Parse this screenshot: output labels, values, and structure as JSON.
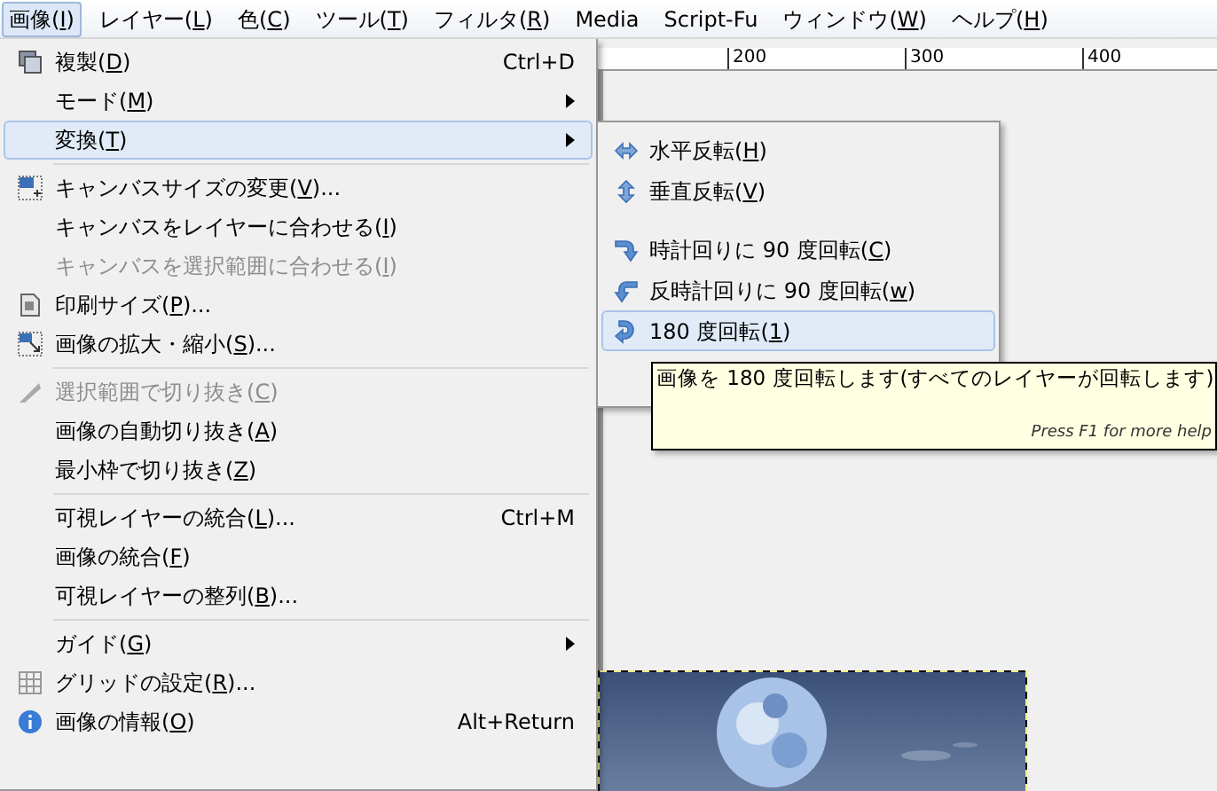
{
  "menubar": [
    {
      "before": "画像(",
      "mnemonic": "I",
      "after": ")",
      "selected": true
    },
    {
      "before": "レイヤー(",
      "mnemonic": "L",
      "after": ")",
      "selected": false
    },
    {
      "before": "色(",
      "mnemonic": "C",
      "after": ")",
      "selected": false
    },
    {
      "before": "ツール(",
      "mnemonic": "T",
      "after": ")",
      "selected": false
    },
    {
      "before": "フィルタ(",
      "mnemonic": "R",
      "after": ")",
      "selected": false
    },
    {
      "before": "Media",
      "selected": false
    },
    {
      "before": "Script-Fu",
      "selected": false
    },
    {
      "before": "ウィンドウ(",
      "mnemonic": "W",
      "after": ")",
      "selected": false
    },
    {
      "before": "ヘルプ(",
      "mnemonic": "H",
      "after": ")",
      "selected": false
    }
  ],
  "ruler": {
    "labels": [
      "200",
      "300",
      "400"
    ]
  },
  "image_menu": {
    "groups": [
      [
        {
          "before": "複製(",
          "mnemonic": "D",
          "after": ")",
          "shortcut": "Ctrl+D",
          "submenu": false,
          "selected": false,
          "disabled": false
        },
        {
          "before": "モード(",
          "mnemonic": "M",
          "after": ")",
          "submenu": true,
          "selected": false,
          "disabled": false
        },
        {
          "before": "変換(",
          "mnemonic": "T",
          "after": ")",
          "submenu": true,
          "selected": true,
          "disabled": false
        }
      ],
      [
        {
          "before": "キャンバスサイズの変更(",
          "mnemonic": "V",
          "after": ")...",
          "submenu": false,
          "selected": false,
          "disabled": false
        },
        {
          "before": "キャンバスをレイヤーに合わせる(",
          "mnemonic": "I",
          "after": ")",
          "submenu": false,
          "selected": false,
          "disabled": false
        },
        {
          "before": "キャンバスを選択範囲に合わせる(",
          "mnemonic": "I",
          "after": ")",
          "submenu": false,
          "selected": false,
          "disabled": true
        },
        {
          "before": "印刷サイズ(",
          "mnemonic": "P",
          "after": ")...",
          "submenu": false,
          "selected": false,
          "disabled": false
        },
        {
          "before": "画像の拡大・縮小(",
          "mnemonic": "S",
          "after": ")...",
          "submenu": false,
          "selected": false,
          "disabled": false
        }
      ],
      [
        {
          "before": "選択範囲で切り抜き(",
          "mnemonic": "C",
          "after": ")",
          "submenu": false,
          "selected": false,
          "disabled": true
        },
        {
          "before": "画像の自動切り抜き(",
          "mnemonic": "A",
          "after": ")",
          "submenu": false,
          "selected": false,
          "disabled": false
        },
        {
          "before": "最小枠で切り抜き(",
          "mnemonic": "Z",
          "after": ")",
          "submenu": false,
          "selected": false,
          "disabled": false
        }
      ],
      [
        {
          "before": "可視レイヤーの統合(",
          "mnemonic": "L",
          "after": ")...",
          "shortcut": "Ctrl+M",
          "submenu": false,
          "selected": false,
          "disabled": false
        },
        {
          "before": "画像の統合(",
          "mnemonic": "F",
          "after": ")",
          "submenu": false,
          "selected": false,
          "disabled": false
        },
        {
          "before": "可視レイヤーの整列(",
          "mnemonic": "B",
          "after": ")...",
          "submenu": false,
          "selected": false,
          "disabled": false
        }
      ],
      [
        {
          "before": "ガイド(",
          "mnemonic": "G",
          "after": ")",
          "submenu": true,
          "selected": false,
          "disabled": false
        },
        {
          "before": "グリッドの設定(",
          "mnemonic": "R",
          "after": ")...",
          "submenu": false,
          "selected": false,
          "disabled": false
        },
        {
          "before": "画像の情報(",
          "mnemonic": "O",
          "after": ")",
          "shortcut": "Alt+Return",
          "submenu": false,
          "selected": false,
          "disabled": false
        }
      ]
    ]
  },
  "transform_menu": {
    "groups": [
      [
        {
          "before": "水平反転(",
          "mnemonic": "H",
          "after": ")",
          "selected": false
        },
        {
          "before": "垂直反転(",
          "mnemonic": "V",
          "after": ")",
          "selected": false
        }
      ],
      [
        {
          "before": "時計回りに 90 度回転(",
          "mnemonic": "C",
          "after": ")",
          "selected": false
        },
        {
          "before": "反時計回りに 90 度回転(",
          "mnemonic": "w",
          "after": ")",
          "selected": false
        },
        {
          "before": "180 度回転(",
          "mnemonic": "1",
          "after": ")",
          "selected": true
        }
      ]
    ]
  },
  "tooltip": {
    "text": "画像を 180 度回転します(すべてのレイヤーが回転します)",
    "help": "Press F1 for more help"
  }
}
